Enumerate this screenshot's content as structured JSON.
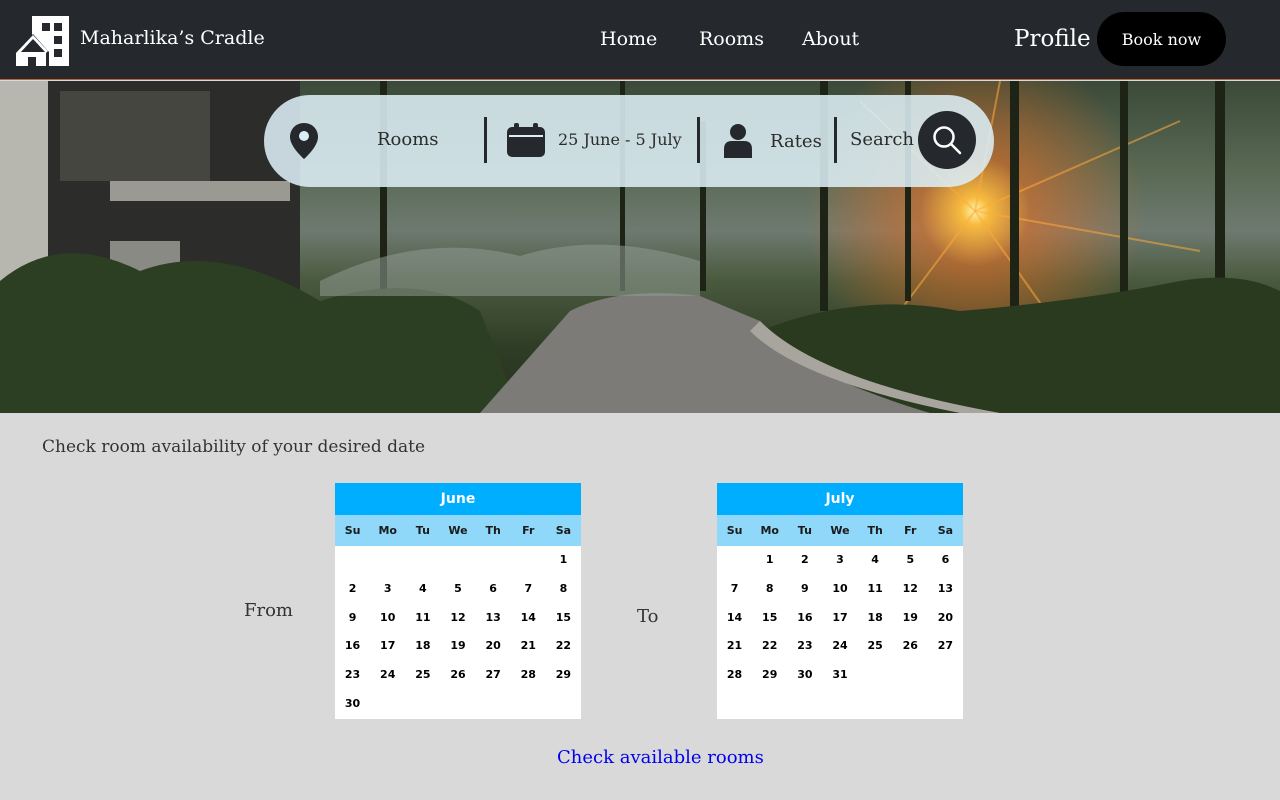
{
  "header": {
    "brand": "Maharlika’s Cradle",
    "nav": [
      "Home",
      "Rooms",
      "About"
    ],
    "profile": "Profile",
    "book_now": "Book now"
  },
  "search": {
    "rooms_label": "Rooms",
    "dates_label": "25 June - 5 July",
    "rates_label": "Rates",
    "search_label": "Search"
  },
  "availability": {
    "heading": "Check room availability of your desired date",
    "from_label": "From",
    "to_label": "To",
    "check_link": "Check available rooms"
  },
  "calendars": [
    {
      "month": "June",
      "weekdays": [
        "Su",
        "Mo",
        "Tu",
        "We",
        "Th",
        "Fr",
        "Sa"
      ],
      "first_weekday": 6,
      "days": 30
    },
    {
      "month": "July",
      "weekdays": [
        "Su",
        "Mo",
        "Tu",
        "We",
        "Th",
        "Fr",
        "Sa"
      ],
      "first_weekday": 1,
      "days": 31
    }
  ],
  "colors": {
    "header_bg": "#25292d",
    "calendar_header": "#00aeff",
    "calendar_weekday_row": "#8fd8f9",
    "link": "#0000ee"
  },
  "icons": [
    "house-logo-icon",
    "location-pin-icon",
    "calendar-icon",
    "person-icon",
    "search-icon"
  ]
}
